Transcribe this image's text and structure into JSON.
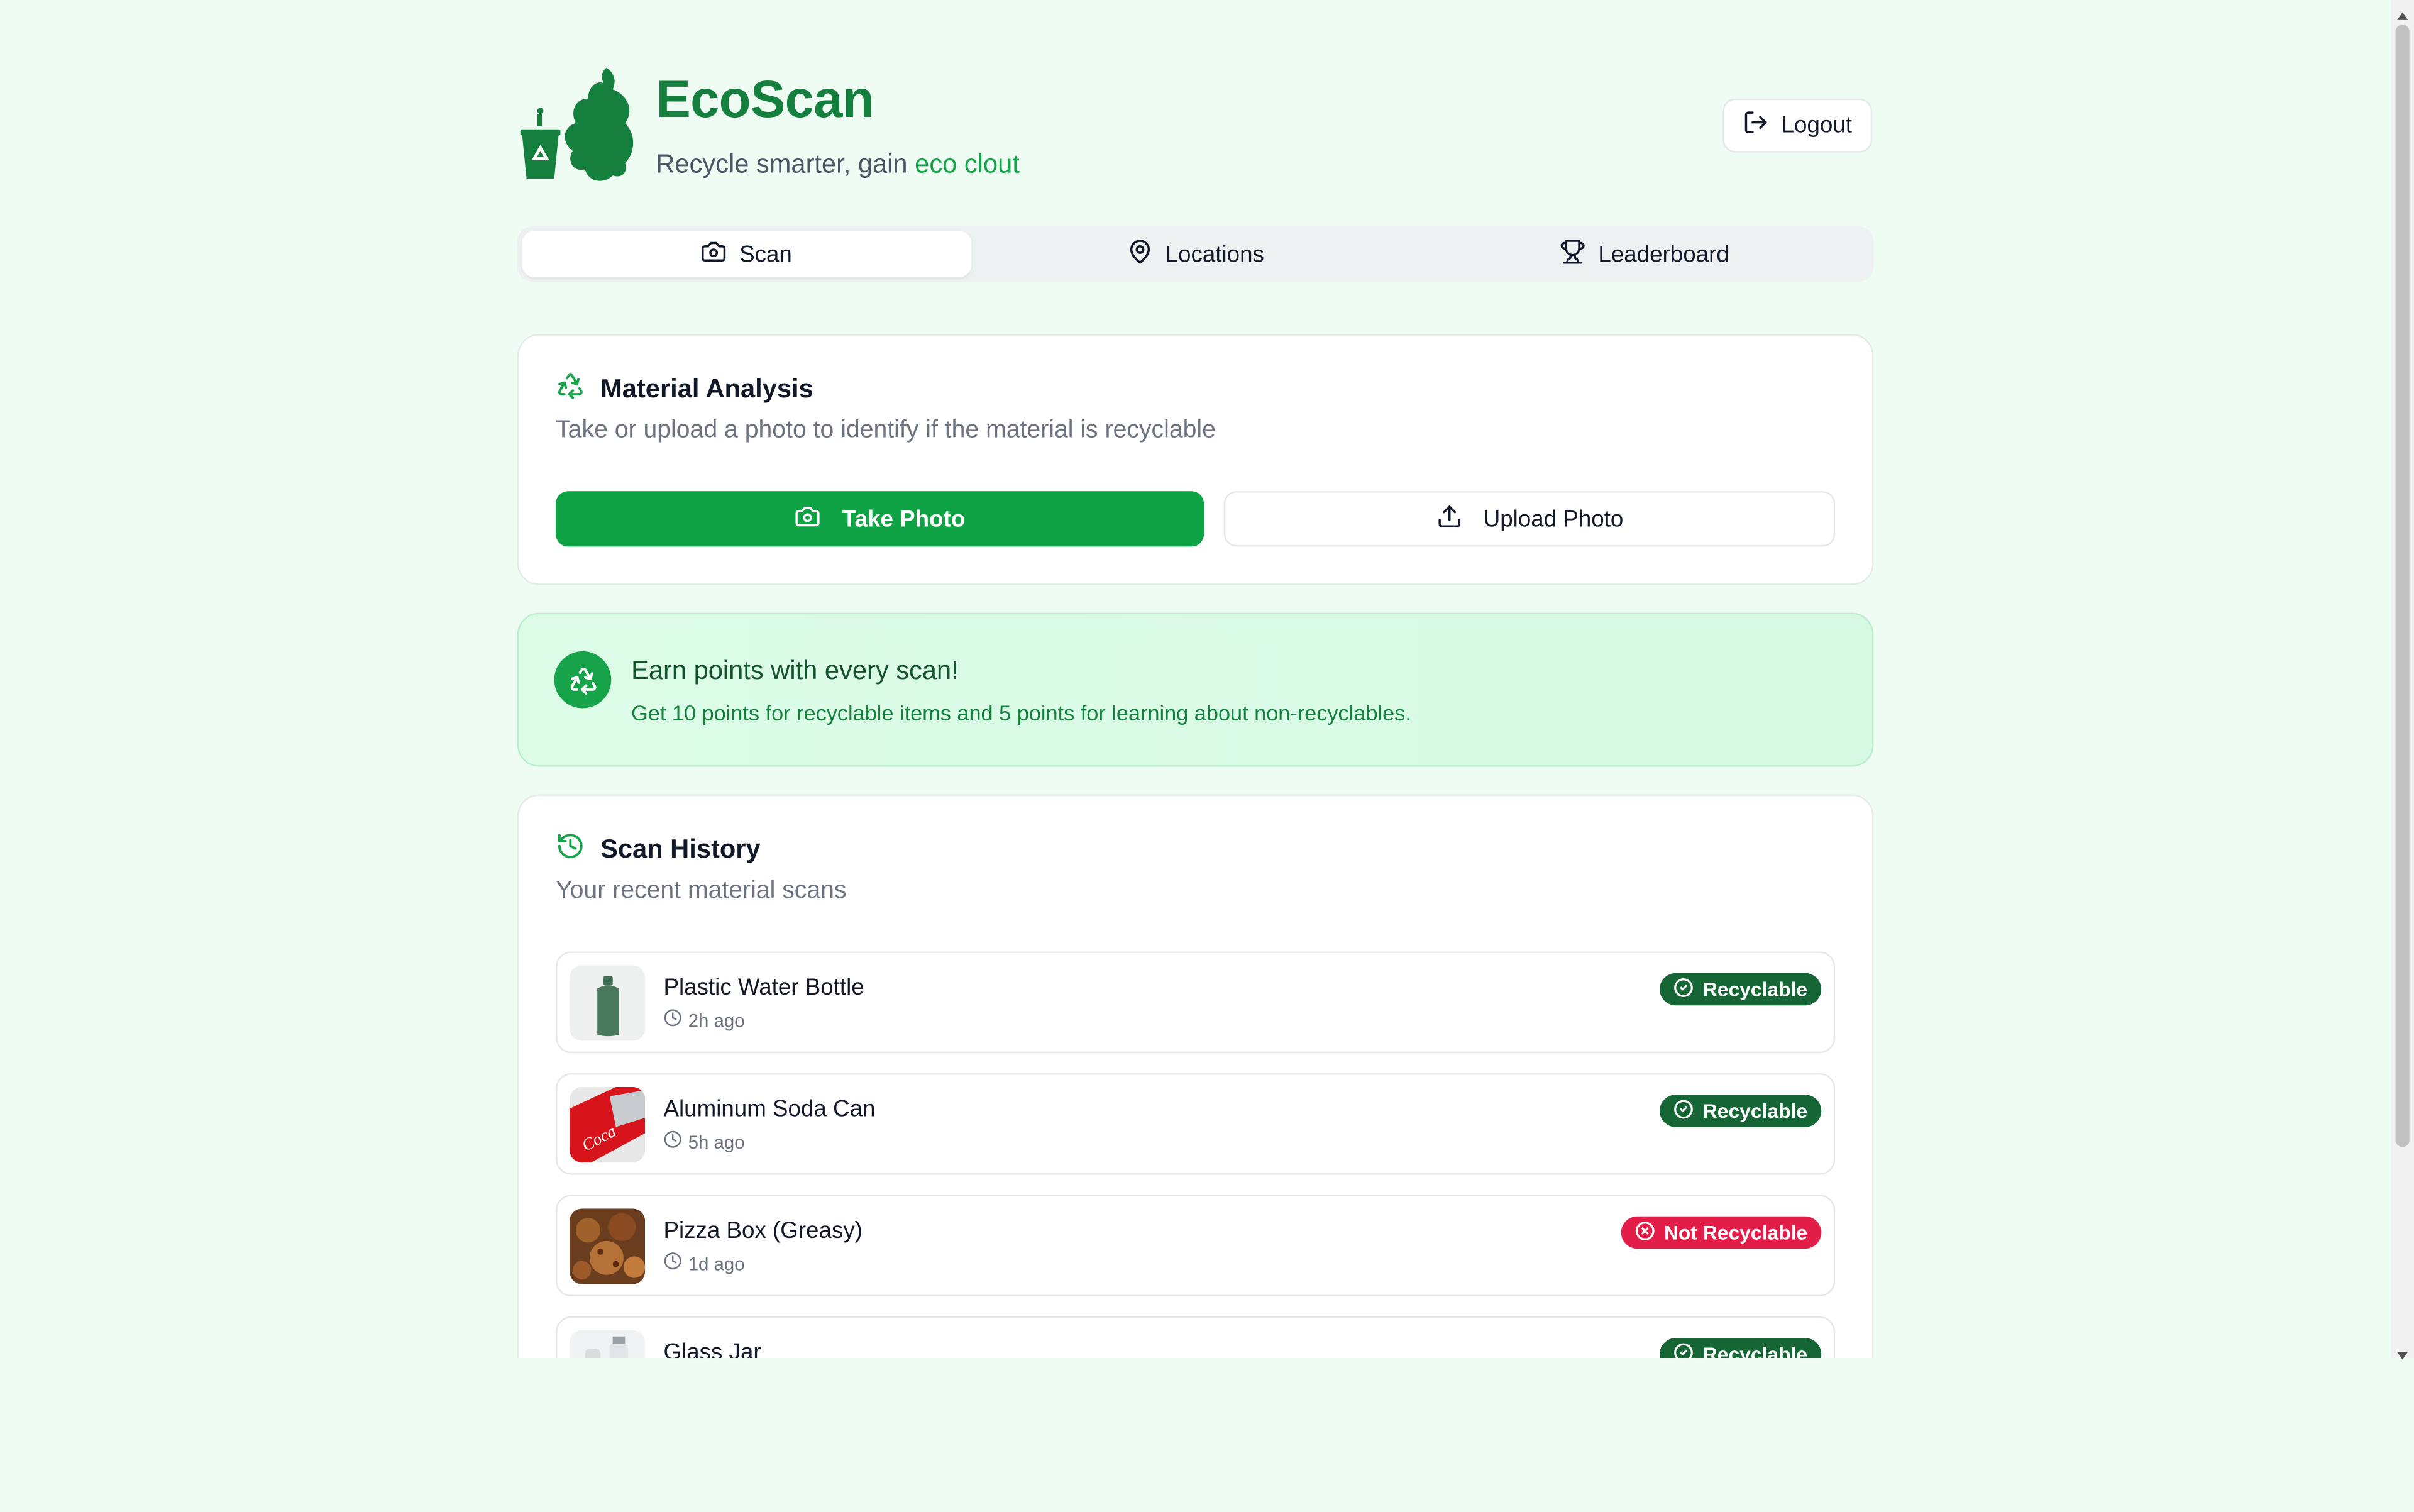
{
  "header": {
    "title": "EcoScan",
    "tagline_prefix": "Recycle smarter, gain ",
    "tagline_accent": "eco clout",
    "logout_label": "Logout"
  },
  "tabs": [
    {
      "label": "Scan",
      "icon": "camera-icon",
      "active": true
    },
    {
      "label": "Locations",
      "icon": "map-pin-icon",
      "active": false
    },
    {
      "label": "Leaderboard",
      "icon": "trophy-icon",
      "active": false
    }
  ],
  "analysis": {
    "title": "Material Analysis",
    "description": "Take or upload a photo to identify if the material is recyclable",
    "take_photo_label": "Take Photo",
    "upload_photo_label": "Upload Photo"
  },
  "promo": {
    "title": "Earn points with every scan!",
    "text": "Get 10 points for recyclable items and 5 points for learning about non-recyclables."
  },
  "history": {
    "title": "Scan History",
    "description": "Your recent material scans",
    "items": [
      {
        "name": "Plastic Water Bottle",
        "time": "2h ago",
        "status": "Recyclable"
      },
      {
        "name": "Aluminum Soda Can",
        "time": "5h ago",
        "status": "Recyclable"
      },
      {
        "name": "Pizza Box (Greasy)",
        "time": "1d ago",
        "status": "Not Recyclable"
      },
      {
        "name": "Glass Jar",
        "time": "",
        "status": "Recyclable"
      }
    ]
  },
  "colors": {
    "brand": "#15803d",
    "primary_button": "#0fa345",
    "recyclable_badge": "#166534",
    "not_recyclable_badge": "#e11d48",
    "background": "#effcf4"
  }
}
